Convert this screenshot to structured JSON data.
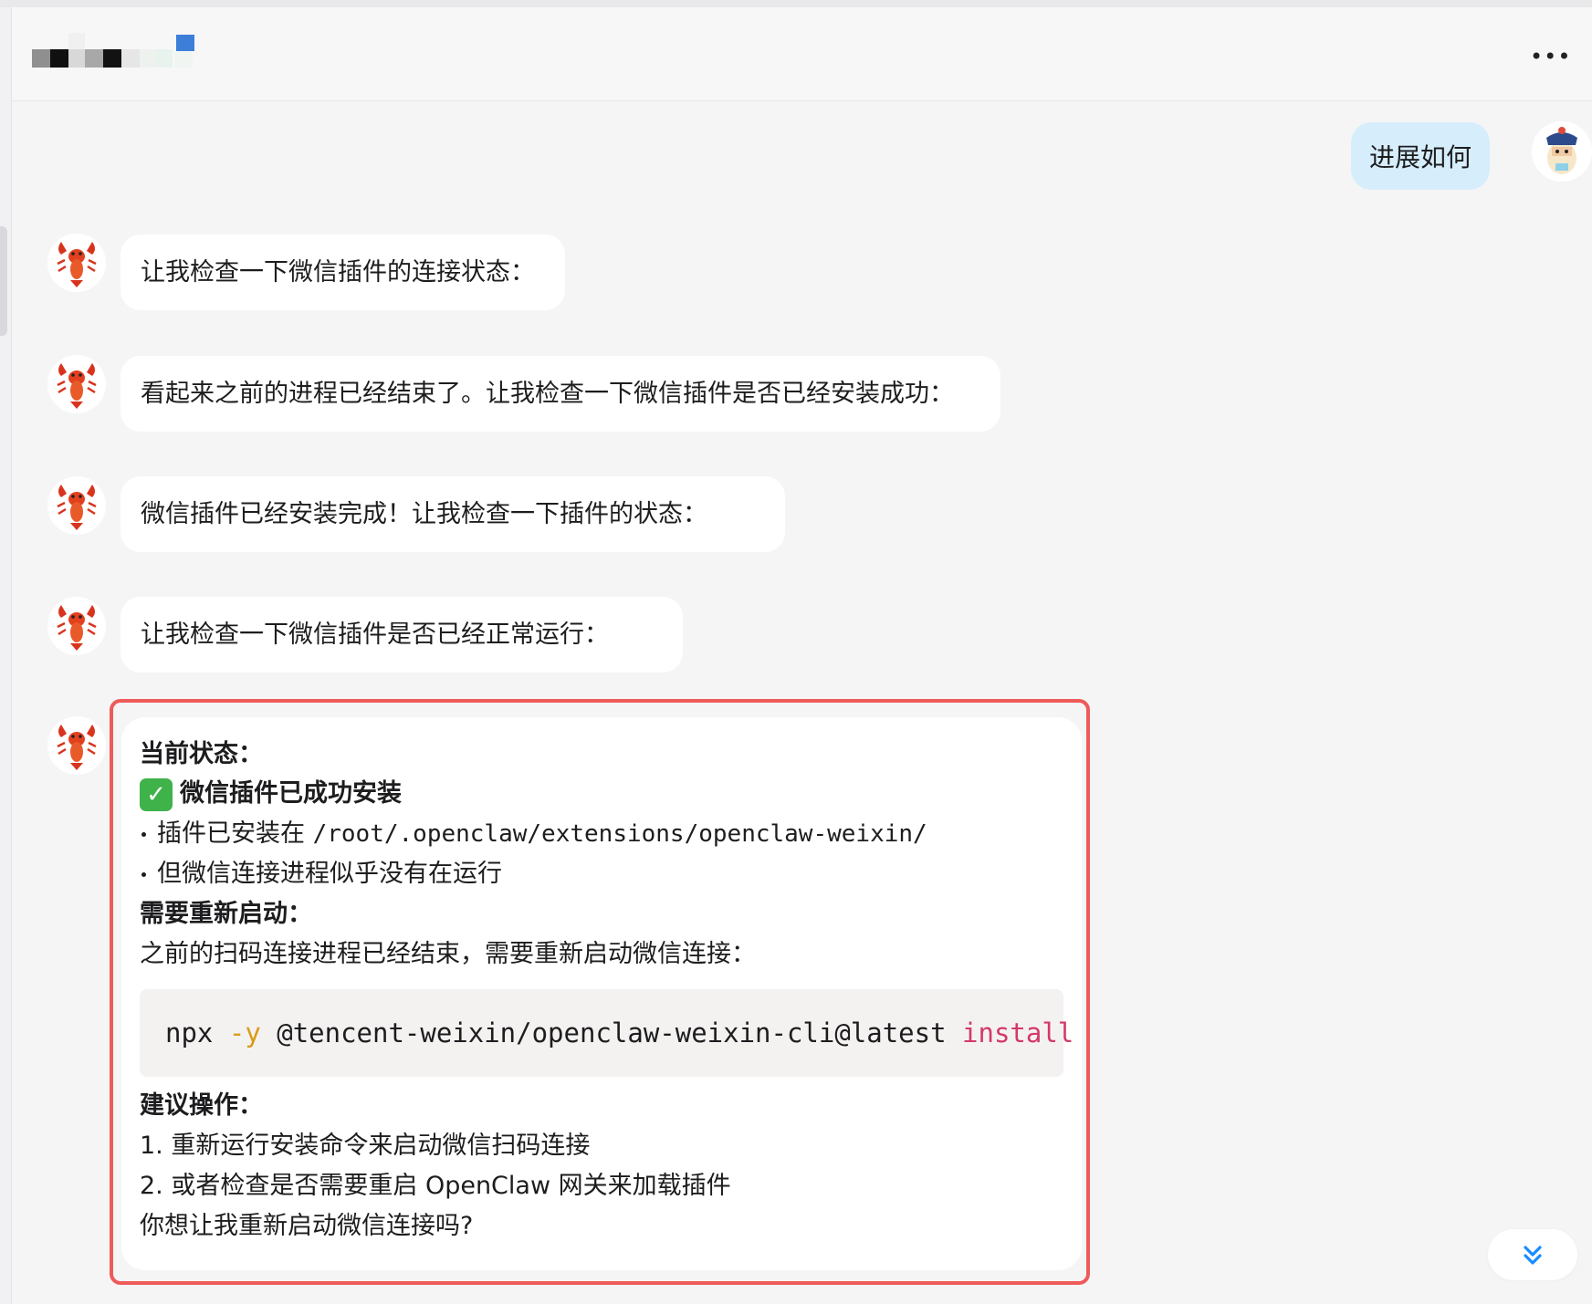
{
  "header": {
    "more_icon": "more-horizontal-icon"
  },
  "user_message": {
    "text": "进展如何",
    "avatar": "user-avatar-icon"
  },
  "bot_avatar_icon": "lobster-icon",
  "messages": [
    {
      "text": "让我检查一下微信插件的连接状态："
    },
    {
      "text": "看起来之前的进程已经结束了。让我检查一下微信插件是否已经安装成功："
    },
    {
      "text": "微信插件已经安装完成！让我检查一下插件的状态："
    },
    {
      "text": "让我检查一下微信插件是否已经正常运行："
    }
  ],
  "status_card": {
    "heading": "当前状态：",
    "check_icon": "check-mark-button-icon",
    "installed_title": "微信插件已成功安装",
    "bullet1_prefix": "插件已安装在 ",
    "bullet1_path": "/root/.openclaw/extensions/openclaw-weixin/",
    "bullet2": "但微信连接进程似乎没有在运行",
    "restart_heading": "需要重新启动：",
    "restart_text": "之前的扫码连接进程已经结束，需要重新启动微信连接：",
    "code": {
      "cmd": "npx",
      "flag": "-y",
      "pkg": "@tencent-weixin/openclaw-weixin-cli@latest",
      "action": "install"
    },
    "suggest_heading": "建议操作：",
    "step1_num": "1.",
    "step1": "重新运行安装命令来启动微信扫码连接",
    "step2_num": "2.",
    "step2": "或者检查是否需要重启 OpenClaw 网关来加载插件",
    "question": "你想让我重新启动微信连接吗?"
  },
  "scroll_button_icon": "chevrons-down-icon",
  "colors": {
    "user_bubble": "#d6eefc",
    "highlight_border": "#ee5b58",
    "code_flag": "#d79c14",
    "code_keyword": "#d3396a",
    "scroll_icon": "#1a8cff"
  }
}
